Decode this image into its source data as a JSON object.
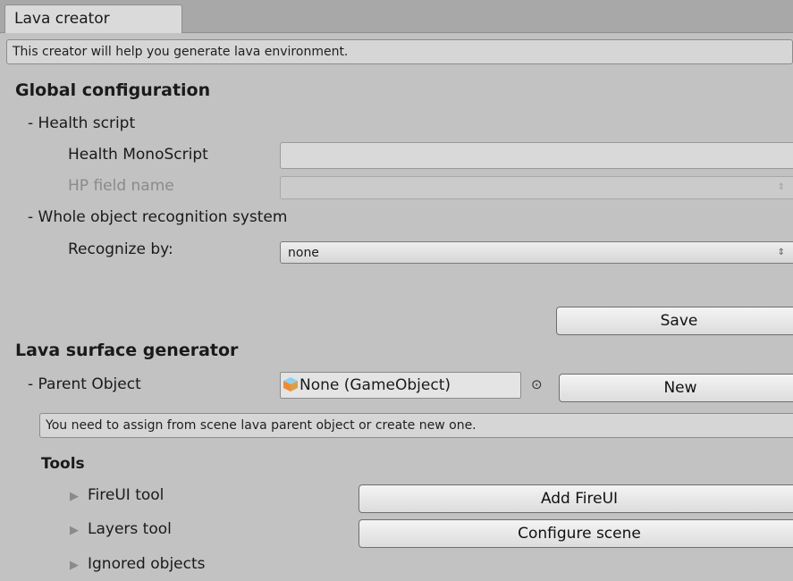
{
  "window": {
    "tab_title": "Lava creator"
  },
  "intro_help": "This creator will help you generate lava environment.",
  "global_configuration": {
    "heading": "Global configuration",
    "health_script_section": "- Health script",
    "health_monoscript_label": "Health MonoScript",
    "health_monoscript_value": "",
    "hp_field_label": "HP field name",
    "hp_field_value": "",
    "recognition_section": "- Whole object recognition system",
    "recognize_by_label": "Recognize by:",
    "recognize_by_value": "none",
    "save_button": "Save"
  },
  "lava_surface_generator": {
    "heading": "Lava surface generator",
    "parent_object_label": "- Parent Object",
    "parent_object_value": "None (GameObject)",
    "picker_icon_glyph": "⊙",
    "new_button": "New",
    "parent_help": "You need to assign from scene lava parent object or create new one.",
    "tools_heading": "Tools",
    "tools": [
      {
        "label": "FireUI tool",
        "button": "Add FireUI",
        "icon": "foldout-arrow-icon"
      },
      {
        "label": "Layers tool",
        "button": "Configure scene",
        "icon": "foldout-arrow-icon"
      },
      {
        "label": "Ignored objects",
        "icon": "foldout-arrow-icon"
      }
    ]
  },
  "icons": {
    "foldout_arrow": "▶",
    "popup_arrows": "⇕"
  },
  "colors": {
    "panel_background": "#c2c2c2",
    "tab_background": "#dadada",
    "disabled_text": "#8a8a8a"
  }
}
